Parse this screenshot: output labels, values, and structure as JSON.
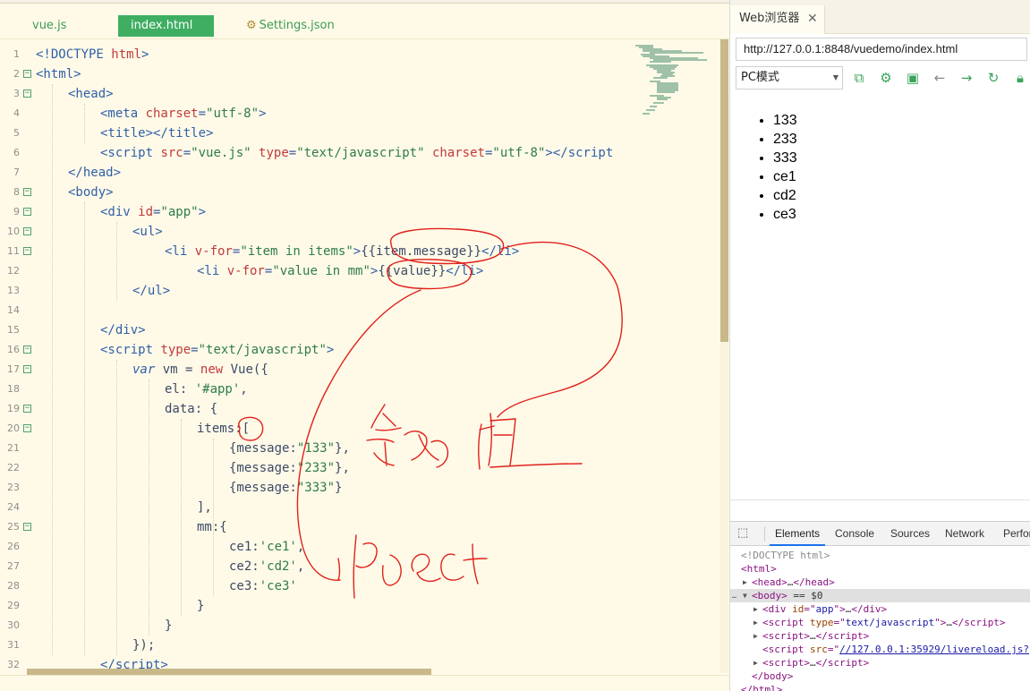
{
  "editor": {
    "tabs": [
      {
        "label": "vue.js",
        "active": false
      },
      {
        "label": "index.html",
        "active": true
      },
      {
        "label": "Settings.json",
        "active": false,
        "icon": "gear-icon"
      }
    ],
    "lines": [
      {
        "n": "1",
        "fold": "",
        "indent": 0,
        "html": "<span class='tg'>&lt;!DOCTYPE <span class='at'>html</span>&gt;</span>"
      },
      {
        "n": "2",
        "fold": "⊟",
        "indent": 0,
        "html": "<span class='tg'>&lt;html&gt;</span>"
      },
      {
        "n": "3",
        "fold": "⊟",
        "indent": 1,
        "html": "<span class='tg'>&lt;head&gt;</span>"
      },
      {
        "n": "4",
        "fold": "",
        "indent": 2,
        "html": "<span class='tg'>&lt;meta </span><span class='at'>charset</span>=<span class='st'>\"utf-8\"</span><span class='tg'>&gt;</span>"
      },
      {
        "n": "5",
        "fold": "",
        "indent": 2,
        "html": "<span class='tg'>&lt;title&gt;&lt;/title&gt;</span>"
      },
      {
        "n": "6",
        "fold": "",
        "indent": 2,
        "html": "<span class='tg'>&lt;script </span><span class='at'>src</span>=<span class='st'>\"vue.js\"</span> <span class='at'>type</span>=<span class='st'>\"text/javascript\"</span> <span class='at'>charset</span>=<span class='st'>\"utf-8\"</span><span class='tg'>&gt;&lt;/script</span>"
      },
      {
        "n": "7",
        "fold": "",
        "indent": 1,
        "html": "<span class='tg'>&lt;/head&gt;</span>"
      },
      {
        "n": "8",
        "fold": "⊟",
        "indent": 1,
        "html": "<span class='tg'>&lt;body&gt;</span>"
      },
      {
        "n": "9",
        "fold": "⊟",
        "indent": 2,
        "html": "<span class='tg'>&lt;div </span><span class='at'>id</span>=<span class='st'>\"app\"</span><span class='tg'>&gt;</span>"
      },
      {
        "n": "10",
        "fold": "⊟",
        "indent": 3,
        "html": "<span class='tg'>&lt;ul&gt;</span>"
      },
      {
        "n": "11",
        "fold": "⊟",
        "indent": 4,
        "html": "<span class='tg'>&lt;li </span><span class='at'>v-for</span>=<span class='st'>\"item in items\"</span><span class='tg'>&gt;</span><span class='pl'>{{item.message}}</span><span class='tg'>&lt;/li&gt;</span>"
      },
      {
        "n": "12",
        "fold": "",
        "indent": 5,
        "html": "<span class='tg'>&lt;li </span><span class='at'>v-for</span>=<span class='st'>\"value in mm\"</span><span class='tg'>&gt;</span><span class='pl'>{{value}}</span><span class='tg'>&lt;/li&gt;</span>"
      },
      {
        "n": "13",
        "fold": "",
        "indent": 3,
        "html": "<span class='tg'>&lt;/ul&gt;</span>"
      },
      {
        "n": "14",
        "fold": "",
        "indent": 0,
        "html": ""
      },
      {
        "n": "15",
        "fold": "",
        "indent": 2,
        "html": "<span class='tg'>&lt;/div&gt;</span>"
      },
      {
        "n": "16",
        "fold": "⊟",
        "indent": 2,
        "html": "<span class='tg'>&lt;script </span><span class='at'>type</span>=<span class='st'>\"text/javascript\"</span><span class='tg'>&gt;</span>"
      },
      {
        "n": "17",
        "fold": "⊟",
        "indent": 3,
        "html": "<span class='kw'>var</span> <span class='pl'>vm = </span><span class='at'>new</span> <span class='pl'>Vue({</span>"
      },
      {
        "n": "18",
        "fold": "",
        "indent": 4,
        "html": "<span class='pl'>el: </span><span class='st'>'#app'</span><span class='pl'>,</span>"
      },
      {
        "n": "19",
        "fold": "⊟",
        "indent": 4,
        "html": "<span class='pl'>data: {</span>"
      },
      {
        "n": "20",
        "fold": "⊟",
        "indent": 5,
        "html": "<span class='pl'>items:[</span>"
      },
      {
        "n": "21",
        "fold": "",
        "indent": 6,
        "html": "<span class='pl'>{message:</span><span class='st'>\"133\"</span><span class='pl'>},</span>"
      },
      {
        "n": "22",
        "fold": "",
        "indent": 6,
        "html": "<span class='pl'>{message:</span><span class='st'>\"233\"</span><span class='pl'>},</span>"
      },
      {
        "n": "23",
        "fold": "",
        "indent": 6,
        "html": "<span class='pl'>{message:</span><span class='st'>\"333\"</span><span class='pl'>}</span>"
      },
      {
        "n": "24",
        "fold": "",
        "indent": 5,
        "html": "<span class='pl'>],</span>"
      },
      {
        "n": "25",
        "fold": "⊟",
        "indent": 5,
        "html": "<span class='pl'>mm:{</span>"
      },
      {
        "n": "26",
        "fold": "",
        "indent": 6,
        "html": "<span class='pl'>ce1:</span><span class='st'>'ce1'</span><span class='pl'>,</span>"
      },
      {
        "n": "27",
        "fold": "",
        "indent": 6,
        "html": "<span class='pl'>ce2:</span><span class='st'>'cd2'</span><span class='pl'>,</span>"
      },
      {
        "n": "28",
        "fold": "",
        "indent": 6,
        "html": "<span class='pl'>ce3:</span><span class='st'>'ce3'</span>"
      },
      {
        "n": "29",
        "fold": "",
        "indent": 5,
        "html": "<span class='pl'>}</span>"
      },
      {
        "n": "30",
        "fold": "",
        "indent": 4,
        "html": "<span class='pl'>}</span>"
      },
      {
        "n": "31",
        "fold": "",
        "indent": 3,
        "html": "<span class='pl'>});</span>"
      },
      {
        "n": "32",
        "fold": "",
        "indent": 2,
        "html": "<span class='tg'>&lt;/script&gt;</span>"
      }
    ]
  },
  "browser": {
    "tab_label": "Web浏览器",
    "close_glyph": "✕",
    "url": "http://127.0.0.1:8848/vuedemo/index.html",
    "mode": "PC模式",
    "list_items": [
      "133",
      "233",
      "333",
      "ce1",
      "cd2",
      "ce3"
    ]
  },
  "devtools": {
    "tabs": [
      "Elements",
      "Console",
      "Sources",
      "Network",
      "Perfor"
    ],
    "active_tab": "Elements",
    "dom_lines": [
      {
        "tri": "",
        "indent": 0,
        "sel": false,
        "html": "<span class='cm'>&lt;!DOCTYPE html&gt;</span>"
      },
      {
        "tri": "",
        "indent": 0,
        "sel": false,
        "html": "&lt;html&gt;"
      },
      {
        "tri": "▶",
        "indent": 1,
        "sel": false,
        "html": "&lt;head&gt;<span class='dlt'>…</span>&lt;/head&gt;"
      },
      {
        "tri": "▼",
        "indent": 1,
        "sel": true,
        "html": "&lt;body&gt; <span class='dlt'>== $0</span>"
      },
      {
        "tri": "▶",
        "indent": 2,
        "sel": false,
        "html": "&lt;div <span class='an'>id</span>=\"<span class='av'>app</span>\"&gt;<span class='dlt'>…</span>&lt;/div&gt;"
      },
      {
        "tri": "▶",
        "indent": 2,
        "sel": false,
        "html": "&lt;script <span class='an'>type</span>=\"<span class='av'>text/javascript</span>\"&gt;<span class='dlt'>…</span>&lt;/script&gt;"
      },
      {
        "tri": "▶",
        "indent": 2,
        "sel": false,
        "html": "&lt;script&gt;<span class='dlt'>…</span>&lt;/script&gt;"
      },
      {
        "tri": "",
        "indent": 2,
        "sel": false,
        "html": "&lt;script <span class='an'>src</span>=\"<span class='lk'>//127.0.0.1:35929/livereload.js?</span>"
      },
      {
        "tri": "▶",
        "indent": 2,
        "sel": false,
        "html": "&lt;script&gt;<span class='dlt'>…</span>&lt;/script&gt;"
      },
      {
        "tri": "",
        "indent": 1,
        "sel": false,
        "html": "&lt;/body&gt;"
      },
      {
        "tri": "",
        "indent": 0,
        "sel": false,
        "html": "&lt;/html&gt;"
      }
    ]
  },
  "colors": {
    "editor_bg": "#fffae8",
    "active_tab": "#3fae62",
    "accent_green": "#3aa35a",
    "annotation_red": "#e0201a"
  }
}
